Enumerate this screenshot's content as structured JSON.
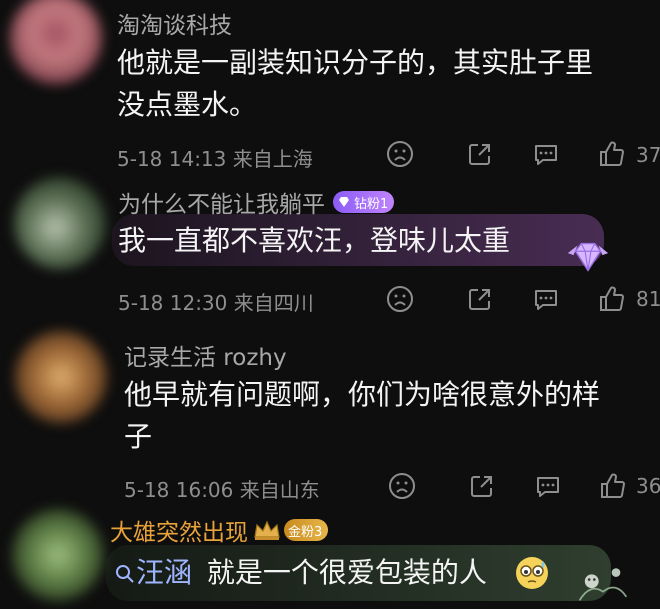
{
  "comments": [
    {
      "username": "淘淘谈科技",
      "text_lines": [
        "他就是一副装知识分子的，其实肚子里",
        "没点墨水。"
      ],
      "date": "5-18 14:13",
      "location": "来自上海",
      "like_count": "37"
    },
    {
      "username": "为什么不能让我躺平",
      "badge": "钻粉1",
      "text_lines": [
        "我一直都不喜欢汪，登味儿太重"
      ],
      "date": "5-18 12:30",
      "location": "来自四川",
      "like_count": "81"
    },
    {
      "username": "记录生活 rozhy",
      "text_lines": [
        "他早就有问题啊，你们为啥很意外的样",
        "子"
      ],
      "date": "5-18 16:06",
      "location": "来自山东",
      "like_count": "36"
    },
    {
      "username": "大雄突然出现",
      "badge": "金粉3",
      "topic_link": "汪涵",
      "text_rest": "就是一个很爱包装的人"
    }
  ],
  "colors": {
    "background": "#0e0e0e",
    "username": "#a8a8a8",
    "vip_username": "#e8a23a",
    "topic_link": "#9fb6ff",
    "meta": "#8e8e8e"
  },
  "icons": [
    "frown-icon",
    "share-icon",
    "reply-icon",
    "thumbs-up-icon",
    "search-icon"
  ]
}
